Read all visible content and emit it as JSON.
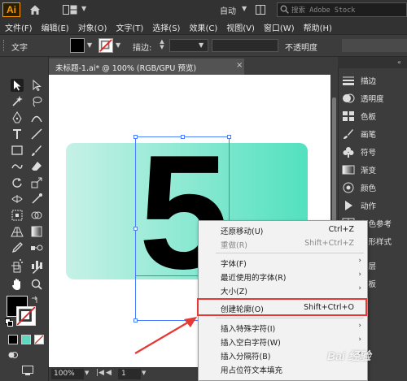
{
  "app": {
    "logo": "Ai",
    "workspace": "自动",
    "search_placeholder": "搜索 Adobe Stock"
  },
  "menubar": {
    "items": [
      "文件(F)",
      "编辑(E)",
      "对象(O)",
      "文字(T)",
      "选择(S)",
      "效果(C)",
      "视图(V)",
      "窗口(W)",
      "帮助(H)"
    ]
  },
  "controlbar": {
    "selection_type": "文字",
    "fill_color": "#000000",
    "stroke_label": "描边:",
    "opacity_label": "不透明度"
  },
  "document": {
    "tab_label": "未标题-1.ai* @ 100% (RGB/GPU 预览)",
    "close_glyph": "×",
    "artwork_text": "5",
    "gradient_start": "#c6f1e6",
    "gradient_end": "#52e1bf"
  },
  "statusbar": {
    "zoom": "100%",
    "artboard_number": "1"
  },
  "right_panel": {
    "items": [
      {
        "label": "描边",
        "icon": "stroke-lines-icon"
      },
      {
        "label": "透明度",
        "icon": "transparency-icon"
      },
      {
        "label": "色板",
        "icon": "swatches-icon"
      },
      {
        "label": "画笔",
        "icon": "brush-icon"
      },
      {
        "label": "符号",
        "icon": "club-symbol-icon"
      },
      {
        "label": "渐变",
        "icon": "gradient-icon"
      },
      {
        "label": "颜色",
        "icon": "color-icon"
      },
      {
        "label": "动作",
        "icon": "play-action-icon"
      },
      {
        "label": "颜色参考",
        "icon": "color-guide-icon"
      },
      {
        "label": "图形样式",
        "icon": "graphic-styles-icon"
      },
      {
        "label": "图层",
        "icon": "layers-icon"
      },
      {
        "label": "画板",
        "icon": "artboards-icon"
      }
    ]
  },
  "context_menu": {
    "items": [
      {
        "label": "还原移动(U)",
        "shortcut": "Ctrl+Z",
        "submenu": false,
        "disabled": false
      },
      {
        "label": "重做(R)",
        "shortcut": "Shift+Ctrl+Z",
        "submenu": false,
        "disabled": true
      },
      {
        "label": "字体(F)",
        "shortcut": "",
        "submenu": true,
        "disabled": false
      },
      {
        "label": "最近使用的字体(R)",
        "shortcut": "",
        "submenu": true,
        "disabled": false
      },
      {
        "label": "大小(Z)",
        "shortcut": "",
        "submenu": true,
        "disabled": false
      },
      {
        "label": "创建轮廓(O)",
        "shortcut": "Shift+Ctrl+O",
        "submenu": false,
        "disabled": false
      },
      {
        "label": "插入特殊字符(I)",
        "shortcut": "",
        "submenu": true,
        "disabled": false
      },
      {
        "label": "插入空白字符(W)",
        "shortcut": "",
        "submenu": true,
        "disabled": false
      },
      {
        "label": "插入分隔符(B)",
        "shortcut": "",
        "submenu": true,
        "disabled": false
      },
      {
        "label": "用占位符文本填充",
        "shortcut": "",
        "submenu": false,
        "disabled": false
      }
    ],
    "submenu_glyph": "›",
    "highlight_color": "#e53935"
  },
  "watermark": {
    "text": "Bai 经验"
  }
}
